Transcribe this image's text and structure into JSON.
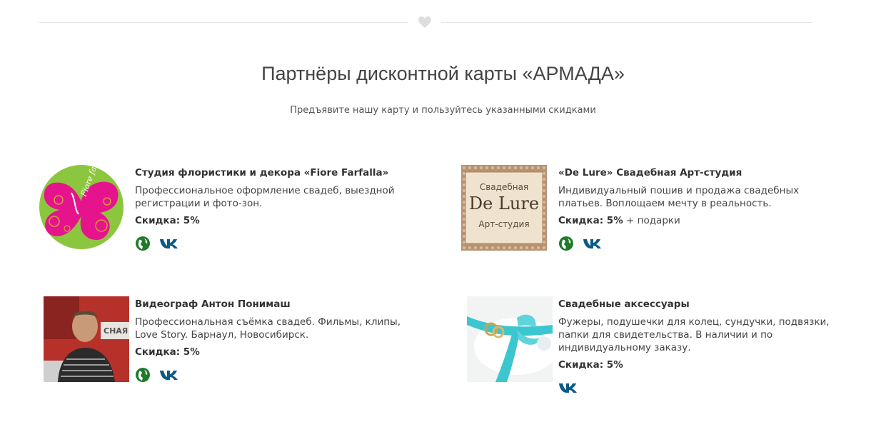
{
  "page": {
    "title": "Партнёры дисконтной карты «АРМАДА»",
    "subtitle": "Предъявите нашу карту и пользуйтесь указанными скидками"
  },
  "colors": {
    "accent_green": "#1f7a2c",
    "vk_blue": "#0e5a86",
    "divider": "#e6e6e6",
    "heart": "#dedede"
  },
  "partners": [
    {
      "name": "Студия флористики и декора «Fiore Farfalla»",
      "description": "Профессиональное оформление свадеб, выездной регистрации и фото-зон.",
      "discount_label": "Скидка: 5%",
      "discount_extra": "",
      "links": [
        "globe-icon",
        "vk-icon"
      ],
      "logo_text": "Fiore farfalla"
    },
    {
      "name": "«De Lure» Свадебная Арт-студия",
      "description": "Индивидуальный пошив и продажа свадебных платьев. Воплощаем мечту в реальность.",
      "discount_label": "Скидка: 5%",
      "discount_extra": " + подарки",
      "links": [
        "globe-icon",
        "vk-icon"
      ],
      "logo_top": "Свадебная",
      "logo_main": "De Lure",
      "logo_bottom": "Арт-студия"
    },
    {
      "name": "Видеограф Антон Понимаш",
      "description": "Профессиональная съёмка свадеб. Фильмы, клипы, Love Story. Барнаул, Новосибирск.",
      "discount_label": "Скидка: 5%",
      "discount_extra": "",
      "links": [
        "globe-icon",
        "vk-icon"
      ],
      "photo_text": "СНАЯ"
    },
    {
      "name": "Свадебные аксессуары",
      "description": "Фужеры, подушечки для колец, сундучки, подвязки, папки для свидетельства. В наличии и по индивидуальному заказу.",
      "discount_label": "Скидка: 5%",
      "discount_extra": "",
      "links": [
        "vk-icon"
      ]
    }
  ]
}
